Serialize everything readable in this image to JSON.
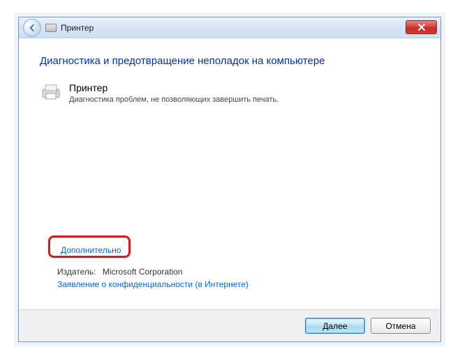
{
  "titlebar": {
    "title": "Принтер"
  },
  "content": {
    "heading": "Диагностика и предотвращение неполадок на компьютере",
    "item": {
      "title": "Принтер",
      "description": "Диагностика проблем, не позволяющих завершить печать."
    },
    "advanced_link": "Дополнительно",
    "publisher_label": "Издатель:",
    "publisher_value": "Microsoft Corporation",
    "privacy_link": "Заявление о конфиденциальности (в Интернете)"
  },
  "footer": {
    "next": "Далее",
    "cancel": "Отмена"
  }
}
